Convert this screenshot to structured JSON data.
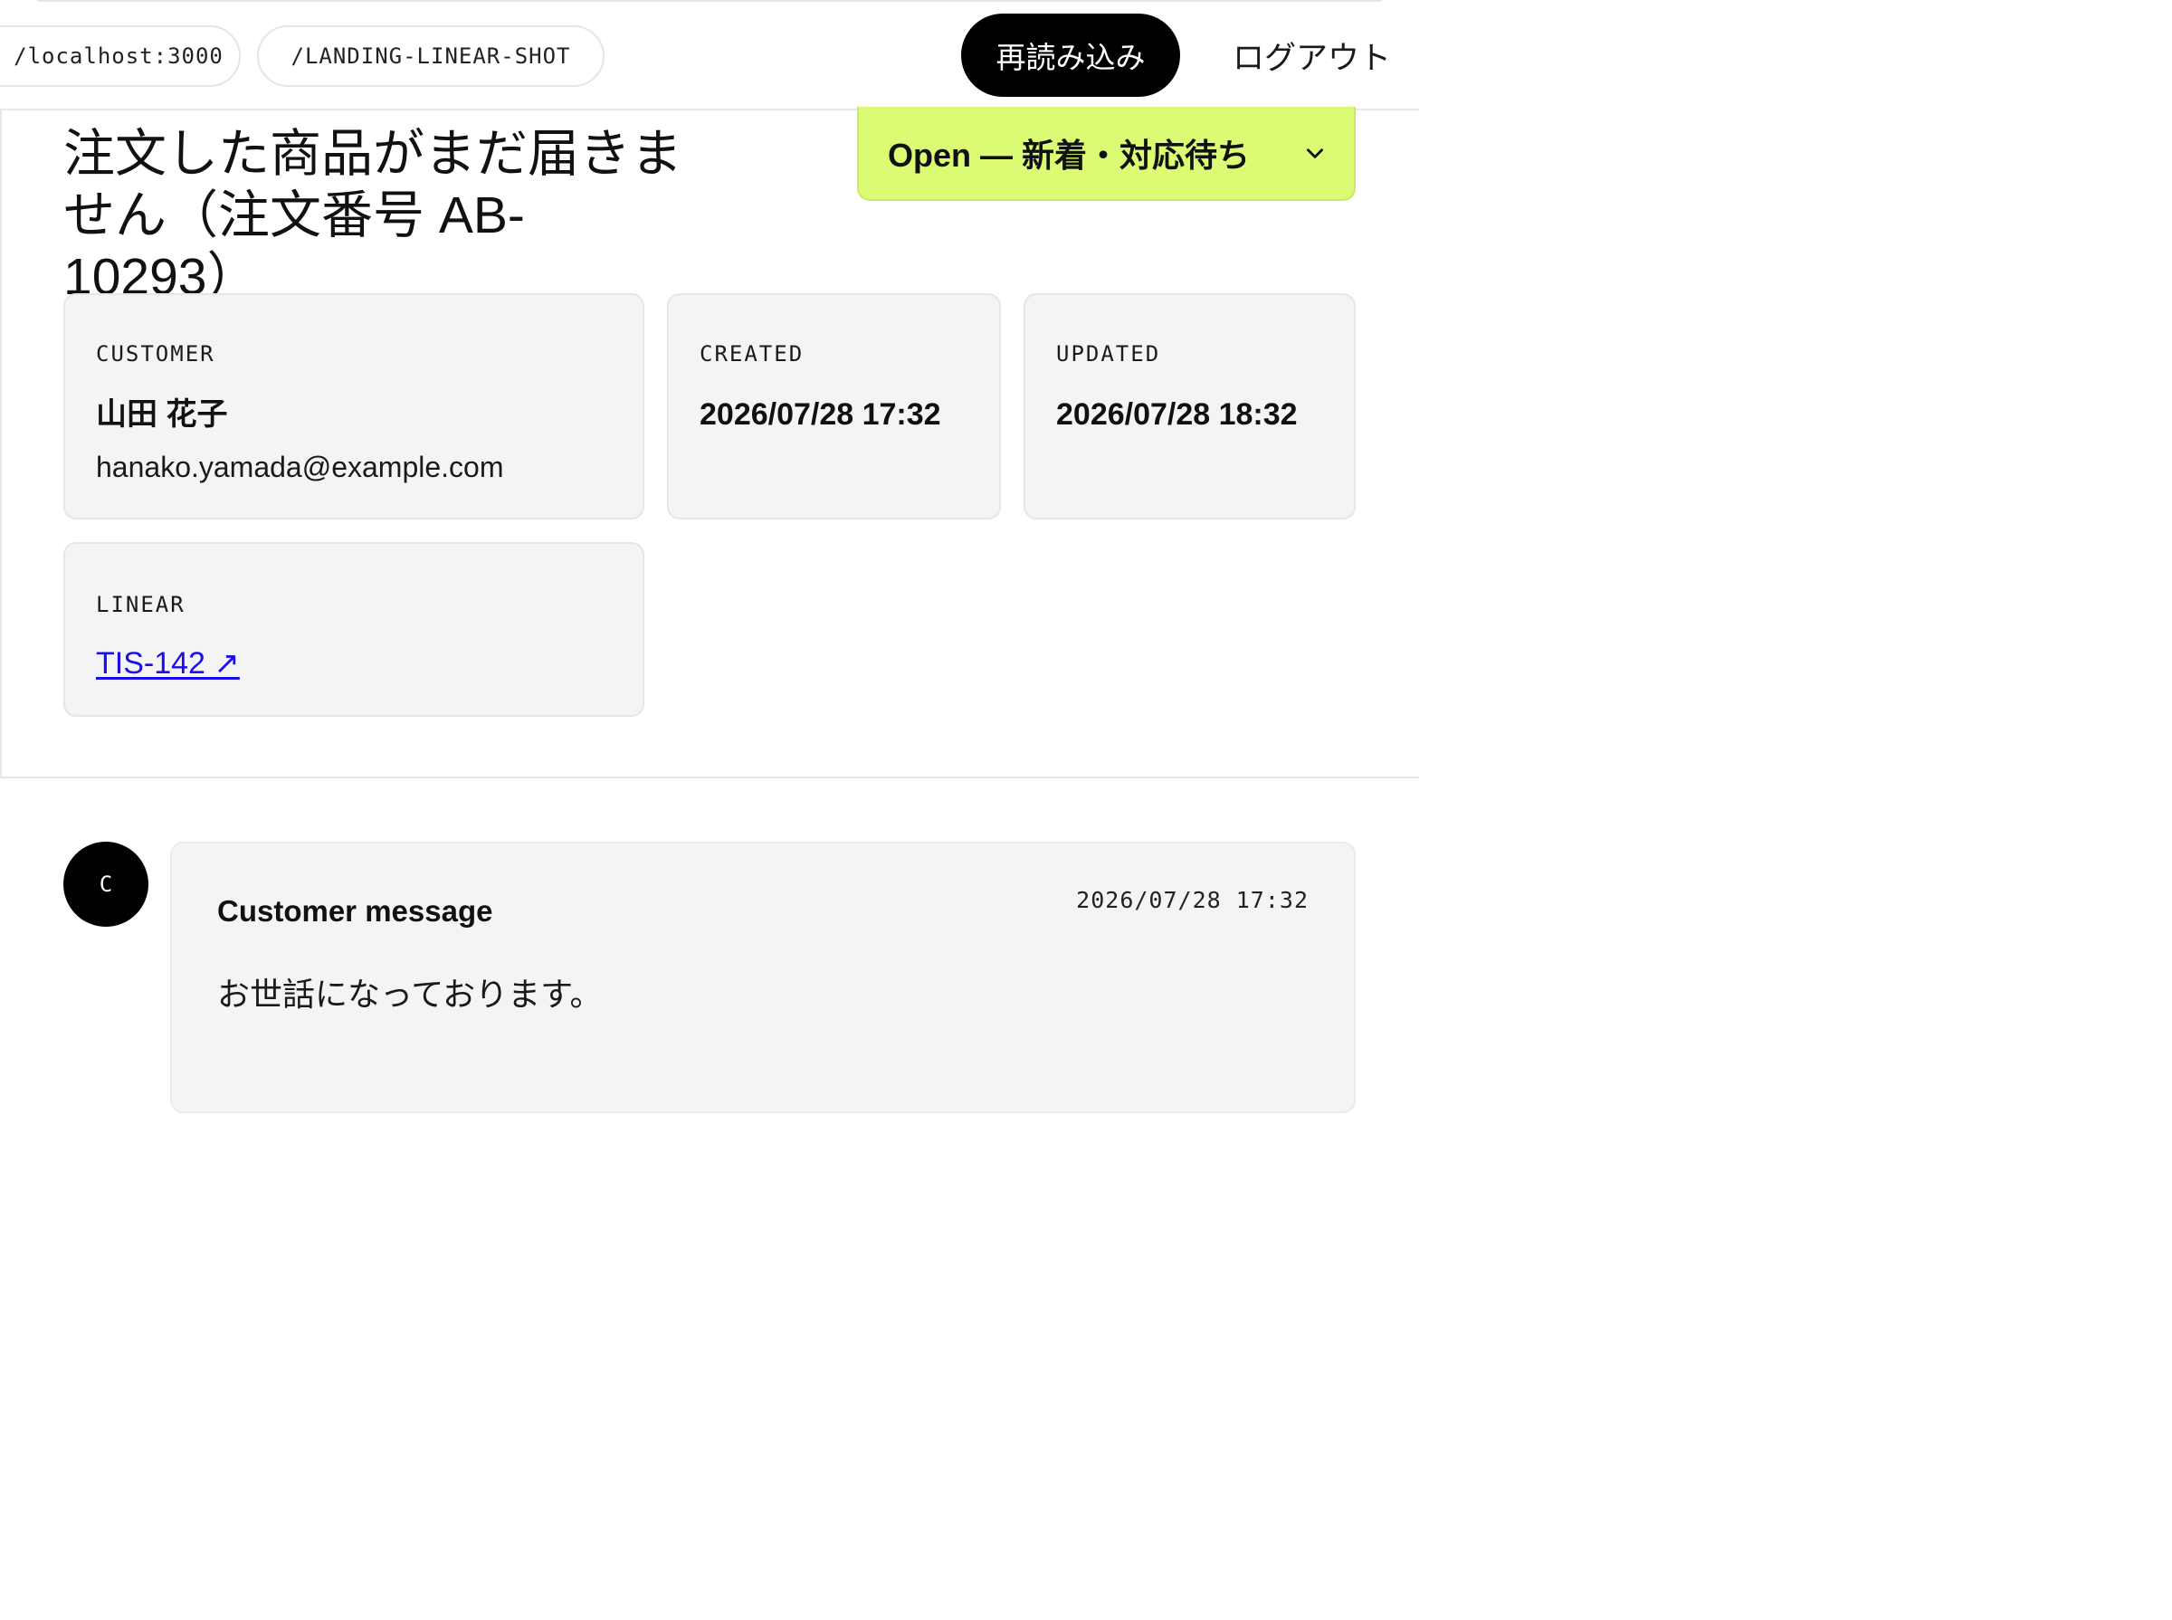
{
  "topbar": {
    "host": "/localhost:3000",
    "path": "/LANDING-LINEAR-SHOT",
    "reload_label": "再読み込み",
    "logout_label": "ログアウト"
  },
  "ticket": {
    "title": "注文した商品がまだ届きません（注文番号 AB-10293）",
    "status": {
      "selected": "Open — 新着・対応待ち",
      "icon": "chevron-down-icon",
      "color": "#dbfb74"
    }
  },
  "cards": {
    "customer": {
      "label": "CUSTOMER",
      "name": "山田 花子",
      "email": "hanako.yamada@example.com"
    },
    "created": {
      "label": "CREATED",
      "value": "2026/07/28 17:32"
    },
    "updated": {
      "label": "UPDATED",
      "value": "2026/07/28 18:32"
    },
    "linear": {
      "label": "LINEAR",
      "link_text": "TIS-142 ↗",
      "link_color": "#1a0dee"
    }
  },
  "thread": {
    "messages": [
      {
        "avatar_initial": "C",
        "author": "Customer message",
        "timestamp": "2026/07/28 17:32",
        "body": "お世話になっております。"
      }
    ]
  }
}
